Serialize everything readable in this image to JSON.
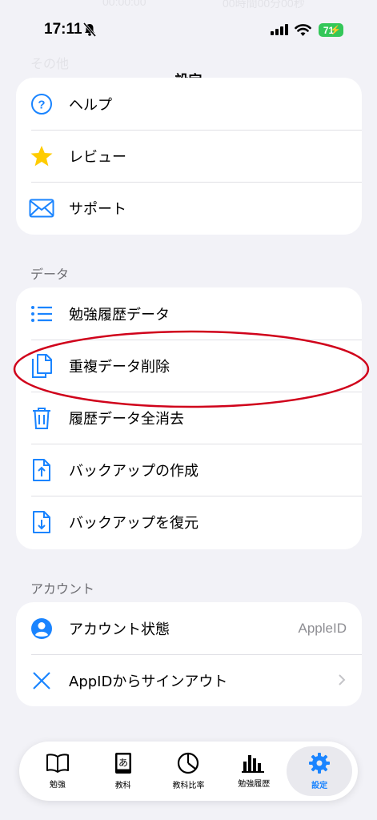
{
  "status_bar": {
    "time": "17:11",
    "battery": "71"
  },
  "ghost": {
    "left": "00:00:00",
    "right": "00時間00分00秒",
    "section": "その他"
  },
  "nav": {
    "title": "設定"
  },
  "other_section": {
    "items": [
      {
        "label": "ヘルプ",
        "icon": "help-circle-icon"
      },
      {
        "label": "レビュー",
        "icon": "star-icon"
      },
      {
        "label": "サポート",
        "icon": "envelope-icon"
      }
    ]
  },
  "data_section": {
    "header": "データ",
    "items": [
      {
        "label": "勉強履歴データ",
        "icon": "list-icon"
      },
      {
        "label": "重複データ削除",
        "icon": "documents-icon"
      },
      {
        "label": "履歴データ全消去",
        "icon": "trash-icon"
      },
      {
        "label": "バックアップの作成",
        "icon": "document-upload-icon"
      },
      {
        "label": "バックアップを復元",
        "icon": "document-download-icon"
      }
    ]
  },
  "account_section": {
    "header": "アカウント",
    "items": [
      {
        "label": "アカウント状態",
        "detail": "AppleID",
        "icon": "person-circle-icon"
      },
      {
        "label": "AppIDからサインアウト",
        "icon": "close-icon"
      }
    ]
  },
  "tabbar": {
    "tabs": [
      {
        "label": "勉強",
        "icon": "book-icon",
        "active": false
      },
      {
        "label": "教科",
        "icon": "dictionary-icon",
        "active": false
      },
      {
        "label": "教科比率",
        "icon": "pie-chart-icon",
        "active": false
      },
      {
        "label": "勉強履歴",
        "icon": "bar-chart-icon",
        "active": false
      },
      {
        "label": "設定",
        "icon": "gear-icon",
        "active": true
      }
    ]
  },
  "colors": {
    "accent": "#1a84ff",
    "star": "#ffcc00",
    "highlight": "#d0021b",
    "battery": "#34c759"
  }
}
